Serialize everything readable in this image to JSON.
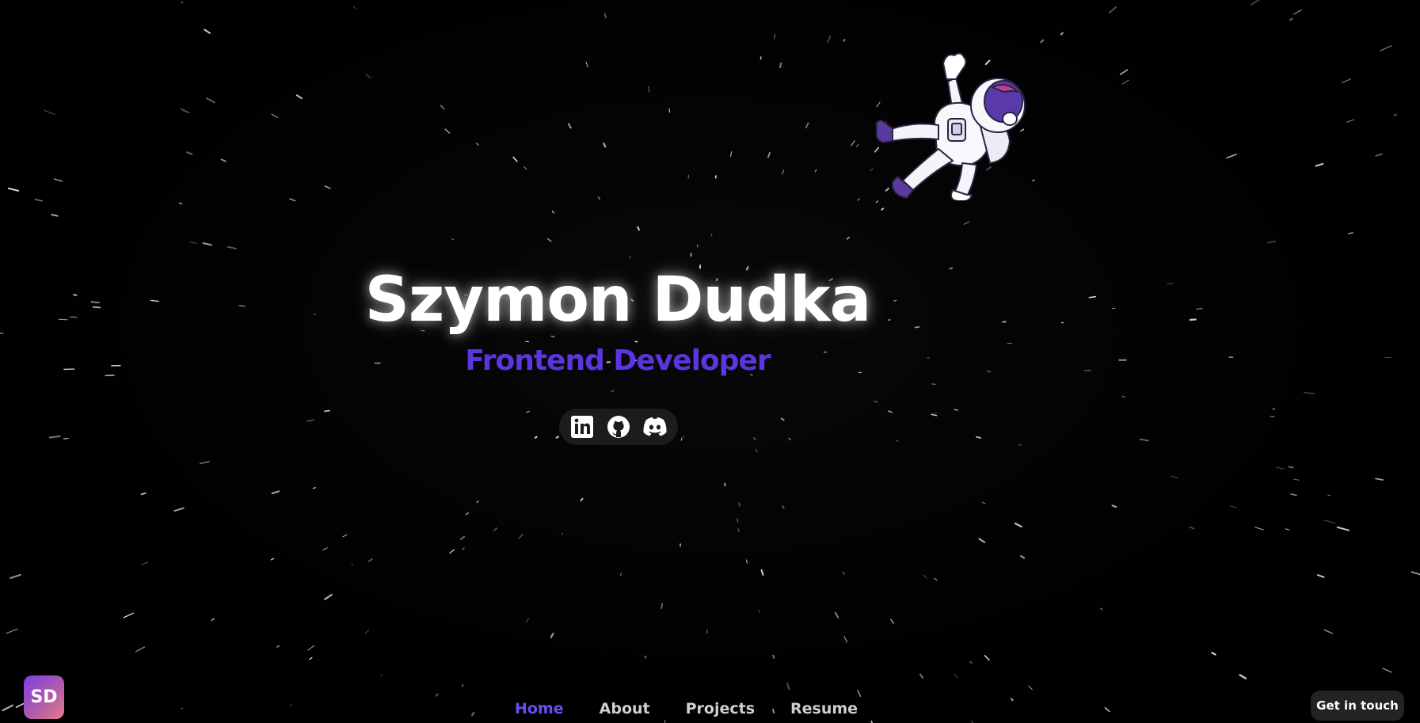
{
  "hero": {
    "name": "Szymon Dudka",
    "role": "Frontend Developer"
  },
  "socials": [
    {
      "icon": "linkedin-icon"
    },
    {
      "icon": "github-icon"
    },
    {
      "icon": "discord-icon"
    }
  ],
  "logo": {
    "initials": "SD"
  },
  "nav": {
    "items": [
      {
        "label": "Home",
        "active": true
      },
      {
        "label": "About",
        "active": false
      },
      {
        "label": "Projects",
        "active": false
      },
      {
        "label": "Resume",
        "active": false
      }
    ]
  },
  "cta": {
    "label": "Get in touch"
  },
  "colors": {
    "background": "#000000",
    "accent": "#5b35e0",
    "nav_active": "#6d4cf2",
    "text": "#ffffff"
  }
}
